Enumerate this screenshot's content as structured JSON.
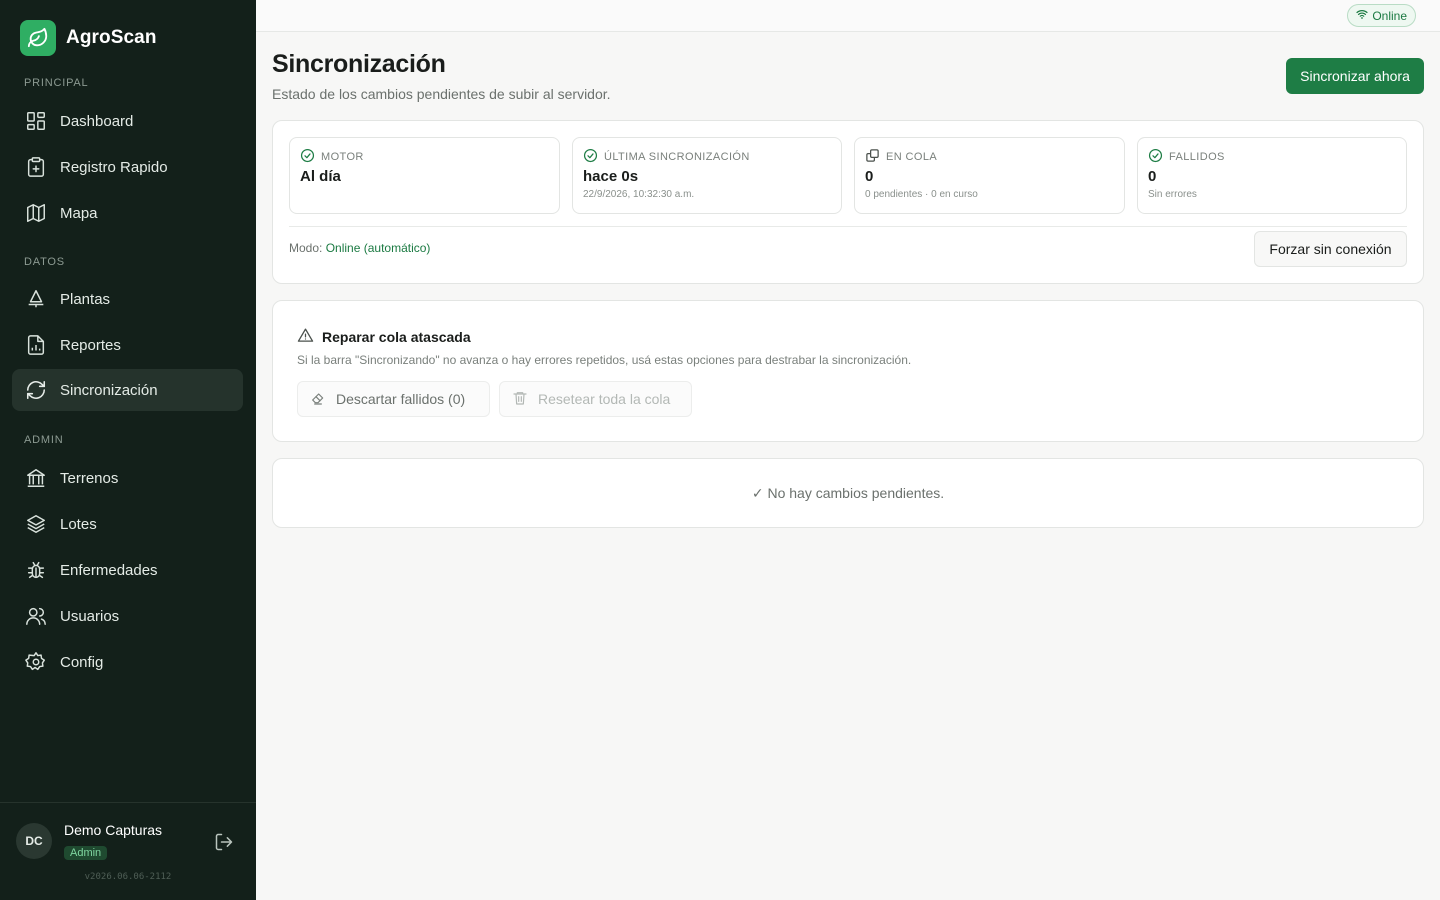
{
  "app": {
    "name": "AgroScan",
    "logo_icon": "leaf-icon",
    "accent": "#1e7d45"
  },
  "sidebar": {
    "sections": [
      {
        "label": "PRINCIPAL"
      },
      {
        "label": "DATOS"
      },
      {
        "label": "ADMIN"
      }
    ],
    "items": [
      {
        "label": "Dashboard",
        "icon": "grid-icon"
      },
      {
        "label": "Registro Rapido",
        "icon": "clipboard-plus-icon"
      },
      {
        "label": "Mapa",
        "icon": "map-icon"
      },
      {
        "label": "Plantas",
        "icon": "sprout-icon"
      },
      {
        "label": "Reportes",
        "icon": "report-icon"
      },
      {
        "label": "Sincronización",
        "icon": "refresh-icon",
        "active": true
      },
      {
        "label": "Terrenos",
        "icon": "landmark-icon"
      },
      {
        "label": "Lotes",
        "icon": "layers-icon"
      },
      {
        "label": "Enfermedades",
        "icon": "bug-icon"
      },
      {
        "label": "Usuarios",
        "icon": "users-icon"
      },
      {
        "label": "Config",
        "icon": "gear-icon"
      }
    ],
    "user": {
      "initials": "DC",
      "name": "Demo Capturas",
      "role": "Admin"
    },
    "version": "v2026.06.06-2112"
  },
  "topbar": {
    "status": "Online"
  },
  "header": {
    "title": "Sincronización",
    "subtitle": "Estado de los cambios pendientes de subir al servidor.",
    "sync_button": "Sincronizar ahora"
  },
  "stats": [
    {
      "label": "MOTOR",
      "value": "Al día",
      "detail": "",
      "icon": "check-circle-icon"
    },
    {
      "label": "ÚLTIMA SINCRONIZACIÓN",
      "value": "hace 0s",
      "detail": "22/9/2026, 10:32:30 a.m.",
      "icon": "check-circle-icon"
    },
    {
      "label": "EN COLA",
      "value": "0",
      "detail": "0 pendientes · 0 en curso",
      "icon": "copy-icon"
    },
    {
      "label": "FALLIDOS",
      "value": "0",
      "detail": "Sin errores",
      "icon": "check-circle-icon"
    }
  ],
  "mode": {
    "label": "Modo:",
    "value": "Online (automático)",
    "offline_button": "Forzar sin conexión"
  },
  "repair": {
    "title": "Reparar cola atascada",
    "description": "Si la barra \"Sincronizando\" no avanza o hay errores repetidos, usá estas opciones para destrabar la sincronización.",
    "discard_button": "Descartar fallidos (0)",
    "reset_button": "Resetear toda la cola"
  },
  "empty_state": "✓ No hay cambios pendientes."
}
